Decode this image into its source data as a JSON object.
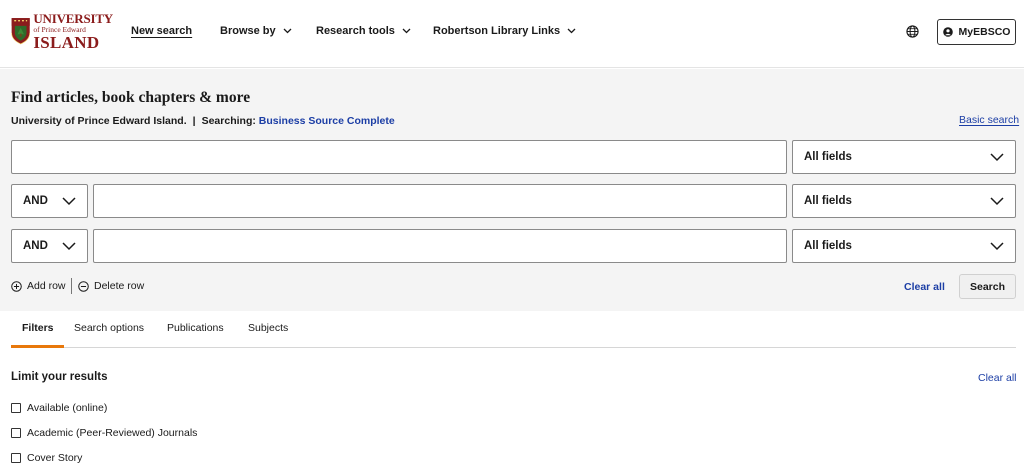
{
  "header": {
    "logo": {
      "line1": "UNIVERSITY",
      "line2": "of Prince Edward",
      "line3": "ISLAND"
    },
    "nav": [
      {
        "label": "New search",
        "active": true,
        "has_chevron": false
      },
      {
        "label": "Browse by",
        "active": false,
        "has_chevron": true
      },
      {
        "label": "Research tools",
        "active": false,
        "has_chevron": true
      },
      {
        "label": "Robertson Library Links",
        "active": false,
        "has_chevron": true
      }
    ],
    "language_icon": "globe-icon",
    "account_label": "MyEBSCO"
  },
  "search": {
    "title": "Find articles, book chapters & more",
    "institution": "University of Prince Edward Island.",
    "separator": "|",
    "searching_label": "Searching:",
    "database": "Business Source Complete",
    "basic_search_label": "Basic search",
    "rows": [
      {
        "operator": "",
        "value": "",
        "field": "All fields"
      },
      {
        "operator": "AND",
        "value": "",
        "field": "All fields"
      },
      {
        "operator": "AND",
        "value": "",
        "field": "All fields"
      }
    ],
    "add_row_label": "Add row",
    "delete_row_label": "Delete row",
    "clear_all_label": "Clear all",
    "search_button_label": "Search"
  },
  "tabs": [
    {
      "label": "Filters",
      "active": true
    },
    {
      "label": "Search options",
      "active": false
    },
    {
      "label": "Publications",
      "active": false
    },
    {
      "label": "Subjects",
      "active": false
    }
  ],
  "filters": {
    "heading": "Limit your results",
    "clear_all_label": "Clear all",
    "options": [
      {
        "label": "Available (online)",
        "checked": false
      },
      {
        "label": "Academic (Peer-Reviewed) Journals",
        "checked": false
      },
      {
        "label": "Cover Story",
        "checked": false
      }
    ]
  },
  "colors": {
    "brand_red": "#8b1c1c",
    "link_blue": "#1c3ea5",
    "tab_accent": "#e8780b",
    "panel_bg": "#f4f4f4"
  }
}
